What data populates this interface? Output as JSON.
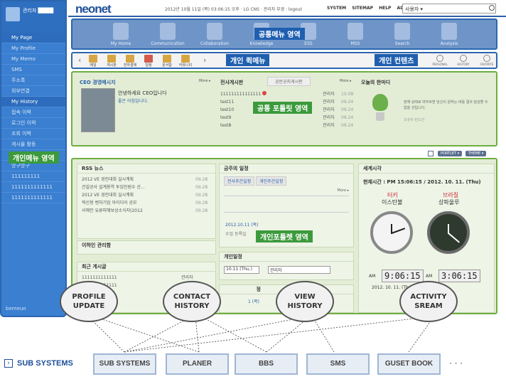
{
  "sidebar": {
    "profile_name": "관리자 ████",
    "items": [
      "My Page",
      "My Profile",
      "My Memo",
      "SMS",
      "주소록",
      "외부연결",
      "My History",
      "접속 이력",
      "로그인 이력",
      "조회 이력",
      "게시물 활동",
      "1111111111",
      "앙구앙구",
      "111111111",
      "1111111111111",
      "1111111111111"
    ],
    "footer": "bemeun",
    "label": "개인메뉴 영역"
  },
  "topbar": {
    "logo": "neonet",
    "info": "2012년 10월 11일 (목) 03:06:15 오후 · LG CNS · 관리자 부경 · logout",
    "links": [
      "SYSTEM",
      "SITEMAP",
      "HELP",
      "ADMIN"
    ],
    "search_placeholder": "사용자 ▾"
  },
  "common_menu": {
    "label": "공통메뉴 영역",
    "items": [
      "My Home",
      "Communication",
      "Collaboration",
      "Knowledge",
      "ESS",
      "MSS",
      "Search",
      "Analysis"
    ]
  },
  "quick_menu": {
    "label": "개인 퀵메뉴",
    "items": [
      "메일",
      "게시판",
      "전자결재",
      "일정",
      "문서함",
      "커뮤니티"
    ],
    "contents_label": "개인 컨텐츠",
    "contents": [
      "PERSONAL",
      "HISTORY",
      "FAVORITE"
    ]
  },
  "common_portlet": {
    "label": "공통 포틀릿 영역",
    "ceo_title": "CEO 경영메시지",
    "ceo_more": "More ▸",
    "ceo_greeting": "안녕하세요 CEO입니다",
    "ceo_sub": "좋은 아침입니다.",
    "board_title": "전사게시판",
    "board_tab2": "공문공지게시판",
    "board_more": "More ▸",
    "board_rows": [
      {
        "title": "111111111111111",
        "writer": "관리자",
        "date": "10.08"
      },
      {
        "title": "test11",
        "writer": "관리자",
        "date": "09.24"
      },
      {
        "title": "test10",
        "writer": "관리자",
        "date": "09.24"
      },
      {
        "title": "test9",
        "writer": "관리자",
        "date": "09.24"
      },
      {
        "title": "test8",
        "writer": "관리자",
        "date": "09.24"
      }
    ],
    "today_title": "오늘의 한마디",
    "today_text": "현재 상태로 머무르면 당신이 원하는 바를 결코 달성할 수 없을 것입니다.",
    "today_author": "조슈아 린드인"
  },
  "portlet_buttons": [
    "PORTLET ▾",
    "THEME ▾"
  ],
  "personal_portlet": {
    "label": "개인포틀렛 영역",
    "rss_title": "RSS 뉴스",
    "rss_rows": [
      {
        "title": "2012 VE 경진대회 실시계획",
        "date": "09.28"
      },
      {
        "title": "건설공사 설계용역 투입인원수 산...",
        "date": "09.28"
      },
      {
        "title": "2012 VE 경진대회 실시계획",
        "date": "09.28"
      },
      {
        "title": "혁신형 벤처기업 아이디어 공모",
        "date": "09.28"
      },
      {
        "title": "서해안 유류피해보상소식지(2012",
        "date": "09.28"
      }
    ],
    "attention_title": "이하인 관리함",
    "recent_title": "최근 게시글",
    "recent_rows": [
      {
        "title": "1111111111111",
        "writer": "관리자"
      },
      {
        "title": "1111111111111",
        "writer": ""
      }
    ],
    "recent_extra": "었다",
    "week_title": "금주의 일정",
    "week_tabs": [
      "전사주간일정",
      "개인주간일정"
    ],
    "week_more": "More ▸",
    "week_date": "2012.10.11 (목)",
    "week_event": "수업 등록일",
    "personal_sched_title": "개인일정",
    "sched_date": "10.11 (Thu.)",
    "sched_user": "관리자",
    "sched2_title": "정",
    "sched2_date": "1 (목)",
    "world_title": "세계시각",
    "current_time": "현재시간 : PM 15:06:15 / 2012. 10. 11. (Thu)",
    "city1_country": "터키",
    "city1": "이스탄불",
    "city2_country": "브라질",
    "city2": "상파울루",
    "clock1_ampm": "AM",
    "clock1_digital": "9:06:15",
    "clock1_date": "2012. 10. 11. (Thu)",
    "clock2_ampm": "AM",
    "clock2_digital": "3:06:15"
  },
  "bubbles": [
    "PROFILE\nUPDATE",
    "CONTACT\nHISTORY",
    "VIEW\nHISTORY",
    "ACTIVITY\nSREAM"
  ],
  "sub_systems": {
    "label": "SUB SYSTEMS",
    "boxes": [
      "SUB SYSTEMS",
      "PLANER",
      "BBS",
      "SMS",
      "GUSET BOOK"
    ],
    "ellipsis": "· · ·"
  },
  "colors": {
    "menu_blue": "#2b66b0",
    "portlet_green": "#6fae3f",
    "label_green": "#3c9a3c"
  }
}
